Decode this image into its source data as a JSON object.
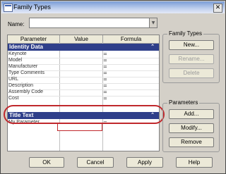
{
  "window": {
    "title": "Family Types",
    "close_glyph": "✕"
  },
  "name": {
    "label": "Name:",
    "value": ""
  },
  "grid": {
    "headers": [
      "Parameter",
      "Value",
      "Formula"
    ],
    "groups": [
      {
        "title": "Identity Data",
        "chevron": "⌃"
      },
      {
        "title": "Title Text",
        "chevron": "⌃"
      }
    ],
    "identity_rows": [
      "Keynote",
      "Model",
      "Manufacturer",
      "Type Comments",
      "URL",
      "Description",
      "Assembly Code",
      "Cost"
    ],
    "title_rows": [
      "My Parameter"
    ],
    "formula_eq": "="
  },
  "family_types": {
    "legend": "Family Types",
    "buttons": [
      "New...",
      "Rename...",
      "Delete"
    ]
  },
  "parameters": {
    "legend": "Parameters",
    "buttons": [
      "Add...",
      "Modify...",
      "Remove"
    ]
  },
  "footer": {
    "buttons": [
      "OK",
      "Cancel",
      "Apply",
      "Help"
    ]
  },
  "colors": {
    "group_header": "#2f3f8a",
    "highlight": "#c0282c",
    "dialog": "#d4d0c8"
  }
}
